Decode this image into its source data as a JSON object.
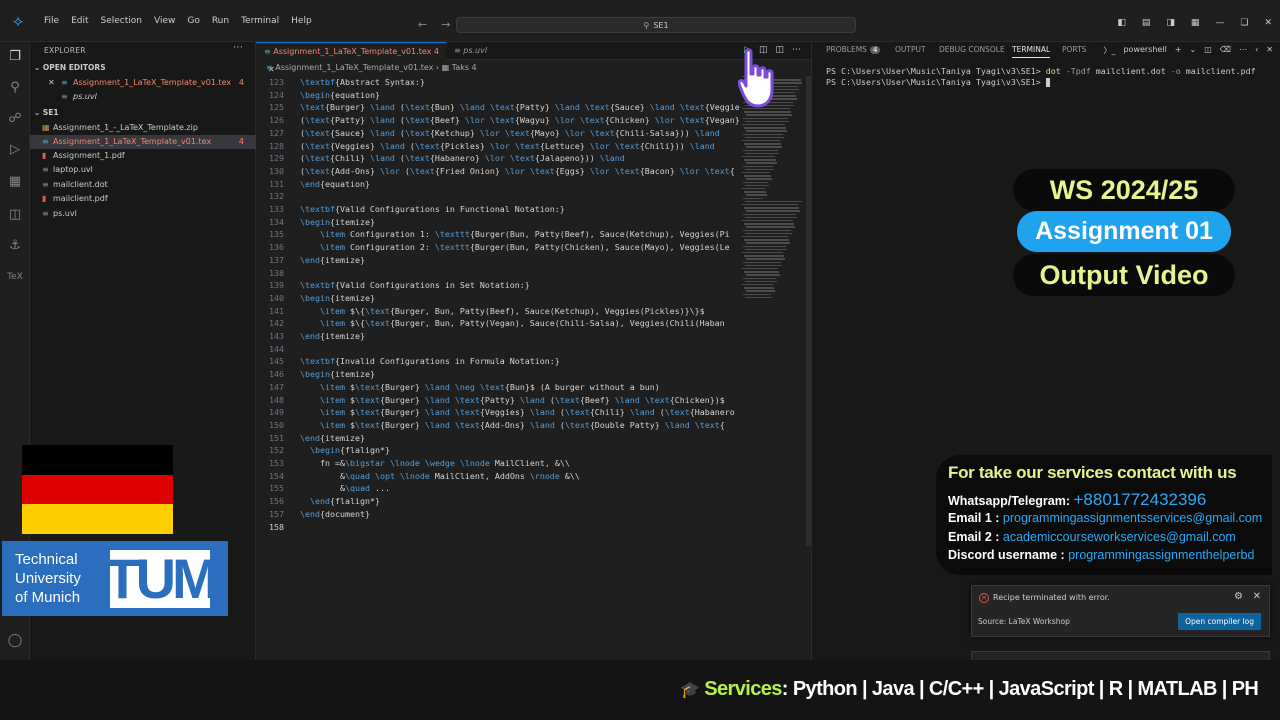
{
  "titlebar": {
    "menu": [
      "File",
      "Edit",
      "Selection",
      "View",
      "Go",
      "Run",
      "Terminal",
      "Help"
    ],
    "search": "SE1"
  },
  "sidebar": {
    "title": "EXPLORER",
    "open_editors_label": "OPEN EDITORS",
    "open_editors": [
      {
        "name": "Assignment_1_LaTeX_Template_v01.tex",
        "problems": "4"
      },
      {
        "name": "ps.uvl"
      }
    ],
    "workspace_label": "SE1",
    "files": [
      {
        "name": "Assignment_1_-_LaTeX_Template.zip"
      },
      {
        "name": "Assignment_1_LaTeX_Template_v01.tex",
        "problems": "4"
      },
      {
        "name": "Assignment_1.pdf"
      },
      {
        "name": "laptop.uvl"
      },
      {
        "name": "mailclient.dot"
      },
      {
        "name": "mailclient.pdf"
      },
      {
        "name": "ps.uvl"
      }
    ]
  },
  "branding": {
    "tum_text": [
      "Technical",
      "University",
      "of Munich"
    ],
    "tum_logo": "TUM",
    "flag_colors": [
      "#000000",
      "#dd0000",
      "#ffce00"
    ]
  },
  "editor": {
    "tabs": [
      {
        "label": "Assignment_1_LaTeX_Template_v01.tex",
        "problems": "4",
        "active": true
      },
      {
        "label": "ps.uvl",
        "active": false
      }
    ],
    "breadcrumb": [
      "Assignment_1_LaTeX_Template_v01.tex",
      "Taks 4"
    ],
    "lines": [
      {
        "n": "123",
        "code": "\\textbf{Abstract Syntax:}"
      },
      {
        "n": "124",
        "code": "\\begin{equation}"
      },
      {
        "n": "125",
        "code": "\\text{Burger} \\land (\\text{Bun} \\land \\text{Patty} \\land \\text{Sauce} \\land \\text{Veggies}"
      },
      {
        "n": "126",
        "code": "(\\text{Patty} \\land (\\text{Beef} \\lor \\text{Wagyu} \\lor \\text{Chicken} \\lor \\text{Vegan}"
      },
      {
        "n": "127",
        "code": "(\\text{Sauce} \\land (\\text{Ketchup} \\lor \\text{Mayo} \\lor \\text{Chili-Salsa})) \\land"
      },
      {
        "n": "128",
        "code": "(\\text{Veggies} \\land (\\text{Pickles} \\lor \\text{Lettuce} \\lor \\text{Chili})) \\land"
      },
      {
        "n": "129",
        "code": "(\\text{Chili} \\land (\\text{Habanero} \\lor \\text{Jalapeno})) \\land"
      },
      {
        "n": "130",
        "code": "(\\text{Add-Ons} \\lor (\\text{Fried Onion} \\lor \\text{Eggs} \\lor \\text{Bacon} \\lor \\text{"
      },
      {
        "n": "131",
        "code": "\\end{equation}"
      },
      {
        "n": "132",
        "code": ""
      },
      {
        "n": "133",
        "code": "\\textbf{Valid Configurations in Functional Notation:}"
      },
      {
        "n": "134",
        "code": "\\begin{itemize}"
      },
      {
        "n": "135",
        "code": "    \\item Configuration 1: \\texttt{Burger(Bun, Patty(Beef), Sauce(Ketchup), Veggies(Pi"
      },
      {
        "n": "136",
        "code": "    \\item Configuration 2: \\texttt{Burger(Bun, Patty(Chicken), Sauce(Mayo), Veggies(Le"
      },
      {
        "n": "137",
        "code": "\\end{itemize}"
      },
      {
        "n": "138",
        "code": ""
      },
      {
        "n": "139",
        "code": "\\textbf{Valid Configurations in Set Notation:}"
      },
      {
        "n": "140",
        "code": "\\begin{itemize}"
      },
      {
        "n": "141",
        "code": "    \\item $\\{\\text{Burger, Bun, Patty(Beef), Sauce(Ketchup), Veggies(Pickles)}\\}$"
      },
      {
        "n": "142",
        "code": "    \\item $\\{\\text{Burger, Bun, Patty(Vegan), Sauce(Chili-Salsa), Veggies(Chili(Haban"
      },
      {
        "n": "143",
        "code": "\\end{itemize}"
      },
      {
        "n": "144",
        "code": ""
      },
      {
        "n": "145",
        "code": "\\textbf{Invalid Configurations in Formula Notation:}"
      },
      {
        "n": "146",
        "code": "\\begin{itemize}"
      },
      {
        "n": "147",
        "code": "    \\item $\\text{Burger} \\land \\neg \\text{Bun}$ (A burger without a bun)"
      },
      {
        "n": "148",
        "code": "    \\item $\\text{Burger} \\land \\text{Patty} \\land (\\text{Beef} \\land \\text{Chicken})$"
      },
      {
        "n": "149",
        "code": "    \\item $\\text{Burger} \\land \\text{Veggies} \\land (\\text{Chili} \\land (\\text{Habanero"
      },
      {
        "n": "150",
        "code": "    \\item $\\text{Burger} \\land \\text{Add-Ons} \\land (\\text{Double Patty} \\land \\text{"
      },
      {
        "n": "151",
        "code": "\\end{itemize}"
      },
      {
        "n": "152",
        "code": "  \\begin{flalign*}"
      },
      {
        "n": "153",
        "code": "    fn =&\\bigstar \\lnode \\wedge \\lnode MailClient, &\\\\"
      },
      {
        "n": "154",
        "code": "        &\\quad \\opt \\lnode MailClient, AddOns \\rnode &\\\\"
      },
      {
        "n": "155",
        "code": "        &\\quad ..."
      },
      {
        "n": "156",
        "code": "  \\end{flalign*}"
      },
      {
        "n": "157",
        "code": "\\end{document}"
      },
      {
        "n": "158",
        "code": ""
      }
    ]
  },
  "panel": {
    "tabs": [
      {
        "label": "PROBLEMS",
        "badge": "4"
      },
      {
        "label": "OUTPUT"
      },
      {
        "label": "DEBUG CONSOLE"
      },
      {
        "label": "TERMINAL",
        "active": true
      },
      {
        "label": "PORTS"
      }
    ],
    "shell": "powershell",
    "terminal": {
      "prompt": "PS C:\\Users\\User\\Music\\Taniya Tyagi\\v3\\SE1>",
      "command": "dot",
      "args": "-Tpdf",
      "rest": "mailclient.dot",
      "args2": "-o",
      "rest2": "mailclient.pdf"
    }
  },
  "overlay": {
    "term": "WS 2024/25",
    "assignment": "Assignment 01",
    "video": "Output Video",
    "contact_heading": "For  take our services contact with us",
    "whatsapp_label": "Whatsapp/Telegram:",
    "whatsapp": "+8801772432396",
    "email1_label": "Email 1 :",
    "email1": "programmingassignmentsservices@gmail.com",
    "email2_label": "Email 2 :",
    "email2": "academiccourseworkservices@gmail.com",
    "discord_label": "Discord username :",
    "discord": "programmingassignmenthelperbd"
  },
  "notification": {
    "message": "Recipe terminated with error.",
    "source": "Source: LaTeX Workshop",
    "button": "Open compiler log"
  },
  "banner": {
    "label": "Services",
    "items": ": Python | Java | C/C++ | JavaScript | R | MATLAB | PH"
  }
}
